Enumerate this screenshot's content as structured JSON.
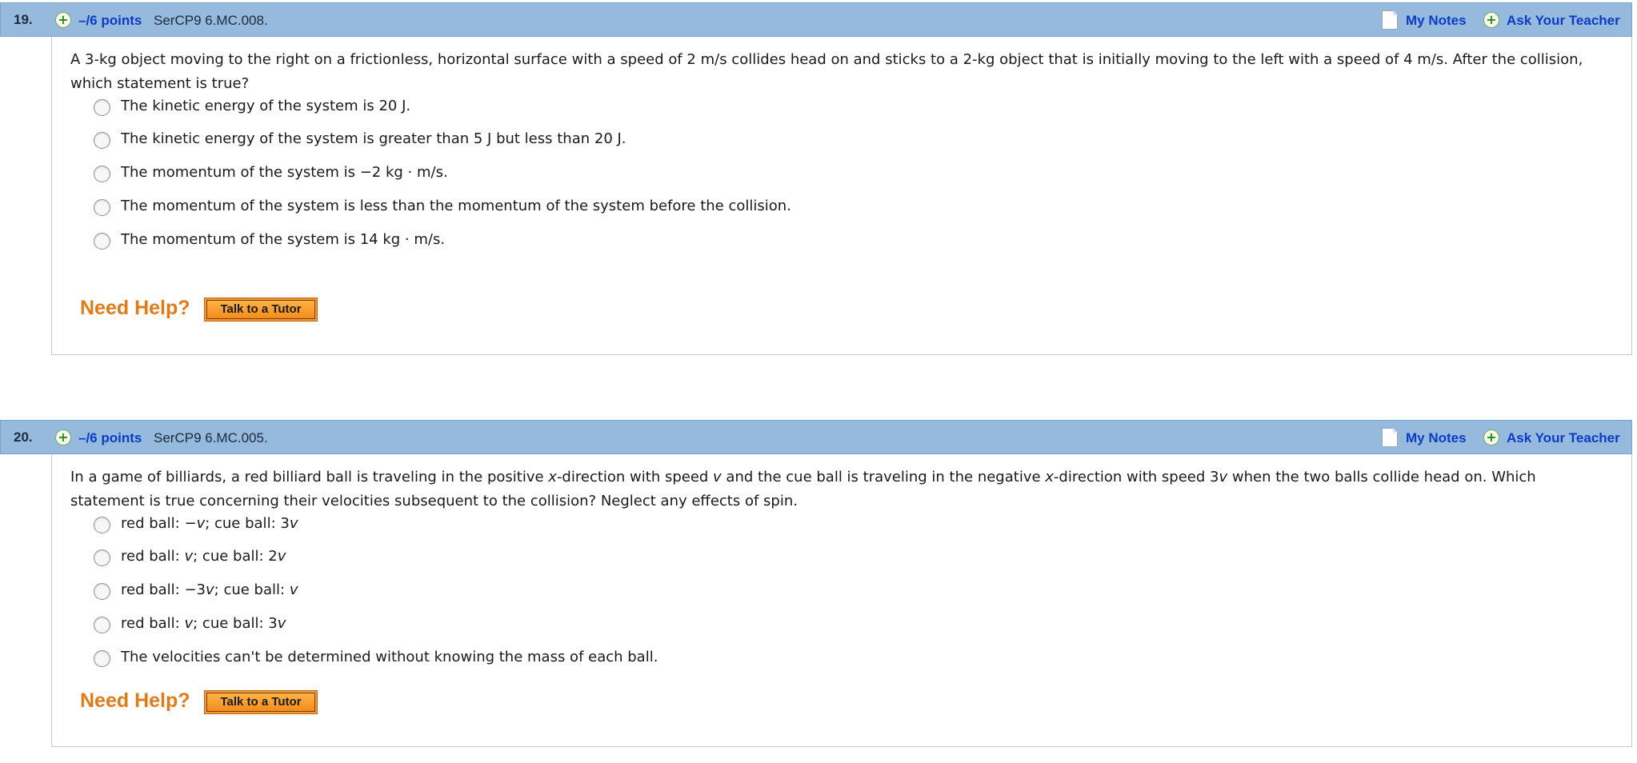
{
  "questions": [
    {
      "number": "19.",
      "points": "–/6 points",
      "code": "SerCP9 6.MC.008.",
      "my_notes": "My Notes",
      "ask_teacher": "Ask Your Teacher",
      "text": "A 3-kg object moving to the right on a frictionless, horizontal surface with a speed of 2 m/s collides head on and sticks to a 2-kg object that is initially moving to the left with a speed of 4 m/s. After the collision, which statement is true?",
      "choices": [
        "The kinetic energy of the system is 20 J.",
        "The kinetic energy of the system is greater than 5 J but less than 20 J.",
        "The momentum of the system is −2 kg · m/s.",
        "The momentum of the system is less than the momentum of the system before the collision.",
        "The momentum of the system is 14 kg · m/s."
      ],
      "need_help": "Need Help?",
      "tutor_button": "Talk to a Tutor"
    },
    {
      "number": "20.",
      "points": "–/6 points",
      "code": "SerCP9 6.MC.005.",
      "my_notes": "My Notes",
      "ask_teacher": "Ask Your Teacher",
      "text": "In a game of billiards, a red billiard ball is traveling in the positive x-direction with speed v and the cue ball is traveling in the negative x-direction with speed 3v when the two balls collide head on. Which statement is true concerning their velocities subsequent to the collision? Neglect any effects of spin.",
      "choices": [
        "red ball: −v; cue ball: 3v",
        "red ball: v; cue ball: 2v",
        "red ball: −3v; cue ball: v",
        "red ball: v; cue ball: 3v",
        "The velocities can't be determined without knowing the mass of each ball."
      ],
      "need_help": "Need Help?",
      "tutor_button": "Talk to a Tutor"
    }
  ],
  "icons": {
    "plus": "plus-circle-icon",
    "notes": "note-page-icon"
  },
  "colors": {
    "header_bg": "#95bade",
    "link": "#0c3bc4",
    "need_help": "#e27b17",
    "tutor_button": "#f49a2f"
  }
}
